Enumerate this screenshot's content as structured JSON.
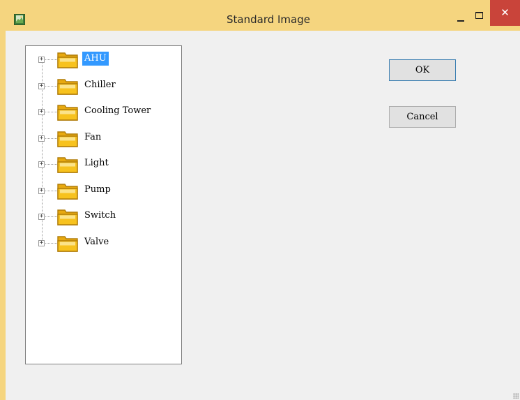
{
  "window": {
    "title": "Standard Image",
    "icon": "image-app-icon",
    "controls": {
      "minimize": "minimize-icon",
      "maximize": "maximize-icon",
      "close_glyph": "✕"
    }
  },
  "tree": {
    "selected_index": 0,
    "items": [
      {
        "label": "AHU",
        "expander": "+",
        "icon": "folder-icon"
      },
      {
        "label": "Chiller",
        "expander": "+",
        "icon": "folder-icon"
      },
      {
        "label": "Cooling Tower",
        "expander": "+",
        "icon": "folder-icon"
      },
      {
        "label": "Fan",
        "expander": "+",
        "icon": "folder-icon"
      },
      {
        "label": "Light",
        "expander": "+",
        "icon": "folder-icon"
      },
      {
        "label": "Pump",
        "expander": "+",
        "icon": "folder-icon"
      },
      {
        "label": "Switch",
        "expander": "+",
        "icon": "folder-icon"
      },
      {
        "label": "Valve",
        "expander": "+",
        "icon": "folder-icon"
      }
    ]
  },
  "buttons": {
    "ok_label": "OK",
    "cancel_label": "Cancel"
  },
  "colors": {
    "titlebar": "#f5d57f",
    "close_button": "#c9443a",
    "selection": "#3399ff",
    "folder_body": "#f7c21e",
    "folder_outline": "#b07d0a"
  }
}
